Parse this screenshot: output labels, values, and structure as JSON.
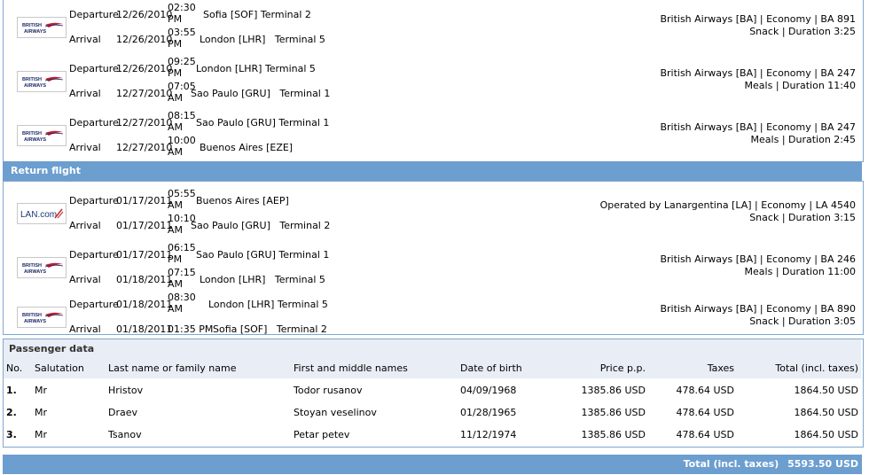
{
  "outbound": [
    {
      "airline": "BA",
      "logo": "british-airways",
      "dep": {
        "kind": "Departure",
        "date": "12/26/2010",
        "time": "02:30\nPM",
        "place": "Sofia [SOF] Terminal 2"
      },
      "arr": {
        "kind": "Arrival",
        "date": "12/26/2010",
        "time": "03:55\nPM",
        "place": "London [LHR]   Terminal 5"
      },
      "info1": "British Airways [BA] | Economy | BA 891",
      "info2": "Snack | Duration 3:25"
    },
    {
      "airline": "BA",
      "logo": "british-airways",
      "dep": {
        "kind": "Departure",
        "date": "12/26/2010",
        "time": "09:25\nPM",
        "place": "London [LHR] Terminal 5"
      },
      "arr": {
        "kind": "Arrival",
        "date": "12/27/2010",
        "time": "07:05\nAM",
        "place": "Sao Paulo [GRU]   Terminal 1"
      },
      "info1": "British Airways [BA] | Economy | BA 247",
      "info2": "Meals | Duration 11:40"
    },
    {
      "airline": "BA",
      "logo": "british-airways",
      "dep": {
        "kind": "Departure",
        "date": "12/27/2010",
        "time": "08:15\nAM",
        "place": "Sao Paulo [GRU] Terminal 1"
      },
      "arr": {
        "kind": "Arrival",
        "date": "12/27/2010",
        "time": "10:00\nAM",
        "place": "Buenos Aires [EZE]"
      },
      "info1": "British Airways [BA] | Economy | BA 247",
      "info2": "Meals | Duration 2:45"
    }
  ],
  "return_label": "Return flight",
  "return": [
    {
      "airline": "LA",
      "logo": "lan",
      "dep": {
        "kind": "Departure",
        "date": "01/17/2011",
        "time": "05:55\nAM",
        "place": "Buenos Aires [AEP]"
      },
      "arr": {
        "kind": "Arrival",
        "date": "01/17/2011",
        "time": "10:10\nAM",
        "place": "Sao Paulo [GRU]   Terminal 2"
      },
      "info1": "Operated by Lanargentina [LA] | Economy | LA 4540",
      "info2": "Snack | Duration 3:15"
    },
    {
      "airline": "BA",
      "logo": "british-airways",
      "dep": {
        "kind": "Departure",
        "date": "01/17/2011",
        "time": "06:15\nPM",
        "place": "Sao Paulo [GRU] Terminal 1"
      },
      "arr": {
        "kind": "Arrival",
        "date": "01/18/2011",
        "time": "07:15\nAM",
        "place": "London [LHR]   Terminal 5"
      },
      "info1": "British Airways [BA] | Economy | BA 246",
      "info2": "Meals | Duration 11:00"
    },
    {
      "airline": "BA",
      "logo": "british-airways",
      "dep": {
        "kind": "Departure",
        "date": "01/18/2011",
        "time": "08:30\nAM",
        "place": "London [LHR] Terminal 5"
      },
      "arr": {
        "kind": "Arrival",
        "date": "01/18/2011",
        "time": "01:35 PM",
        "place": "Sofia [SOF]   Terminal 2"
      },
      "info1": "British Airways [BA] | Economy | BA 890",
      "info2": "Snack | Duration 3:05"
    }
  ],
  "logos": {
    "british-airways": [
      "BRITISH",
      "AIRWAYS"
    ],
    "lan": "LAN.com"
  },
  "passengers": {
    "title": "Passenger data",
    "headers": [
      "No.",
      "Salutation",
      "Last name or family name",
      "First and middle names",
      "Date of birth",
      "Price p.p.",
      "Taxes",
      "Total (incl. taxes)"
    ],
    "rows": [
      [
        "1.",
        "Mr",
        "Hristov",
        "Todor rusanov",
        "04/09/1968",
        "1385.86 USD",
        "478.64 USD",
        "1864.50 USD"
      ],
      [
        "2.",
        "Mr",
        "Draev",
        "Stoyan veselinov",
        "01/28/1965",
        "1385.86 USD",
        "478.64 USD",
        "1864.50 USD"
      ],
      [
        "3.",
        "Mr",
        "Tsanov",
        "Petar petev",
        "11/12/1974",
        "1385.86 USD",
        "478.64 USD",
        "1864.50 USD"
      ]
    ]
  },
  "total": {
    "label": "Total (incl. taxes)",
    "value": "5593.50 USD"
  },
  "colors": {
    "bar": "#6c9ecf",
    "header_bg": "#e9eef6",
    "border": "#7fa7cf"
  }
}
